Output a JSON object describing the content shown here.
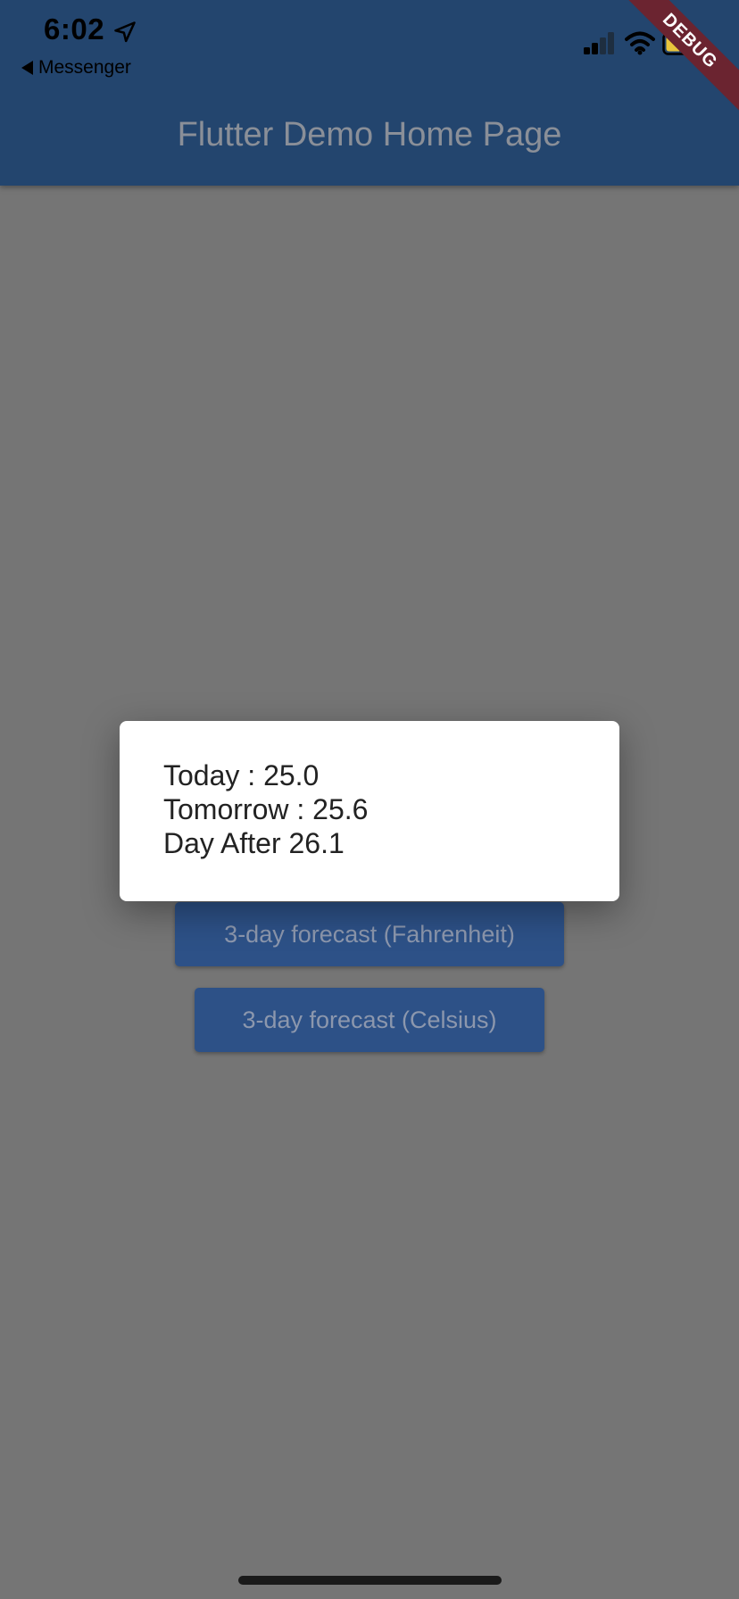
{
  "status_bar": {
    "time": "6:02",
    "back_app": "Messenger"
  },
  "app_bar": {
    "title": "Flutter Demo Home Page",
    "debug_banner": "DEBUG",
    "background_color": "#23456e"
  },
  "buttons": {
    "fahrenheit": "3-day forecast (Fahrenheit)",
    "celsius": "3-day forecast (Celsius)"
  },
  "dialog": {
    "lines": [
      "Today : 25.0",
      "Tomorrow : 25.6",
      "Day After 26.1"
    ]
  },
  "icons": {
    "location": "location-arrow-icon",
    "signal": "cellular-signal-icon",
    "wifi": "wifi-icon",
    "battery": "battery-charging-icon"
  },
  "colors": {
    "button": "#2d5187",
    "scrim": "#757575"
  }
}
